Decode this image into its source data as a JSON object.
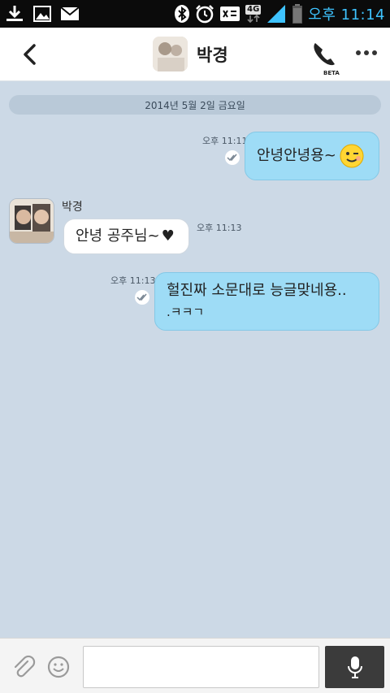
{
  "status_bar": {
    "left_icons": [
      "download-icon",
      "image-icon",
      "mail-icon"
    ],
    "right_icons": [
      "bluetooth-icon",
      "alarm-icon",
      "data-off-icon",
      "signal-icon",
      "battery-icon"
    ],
    "network": "4G",
    "time": "오후 11:14"
  },
  "header": {
    "contact_name": "박경",
    "call_badge": "BETA"
  },
  "chat": {
    "date_divider": "2014년 5월 2일 금요일",
    "messages": [
      {
        "direction": "outgoing",
        "time": "오후 11:11",
        "text": "안녕안녕용~",
        "emoji": "wink-emoticon",
        "read_receipt": "double-check-icon"
      },
      {
        "direction": "incoming",
        "sender": "박경",
        "time": "오후 11:13",
        "text": "안녕 공주님~",
        "trailing_symbol": "♥"
      },
      {
        "direction": "outgoing",
        "time": "오후 11:13",
        "line1": "헐진짜 소문대로 능글맞네용..",
        "line2": ".ㅋㅋㄱ",
        "read_receipt": "double-check-icon"
      }
    ]
  },
  "input": {
    "value": "",
    "placeholder": ""
  },
  "colors": {
    "background": "#ccd9e6",
    "outgoing_bubble": "#9edcf6",
    "incoming_bubble": "#ffffff",
    "status_time": "#3ec3ff"
  }
}
